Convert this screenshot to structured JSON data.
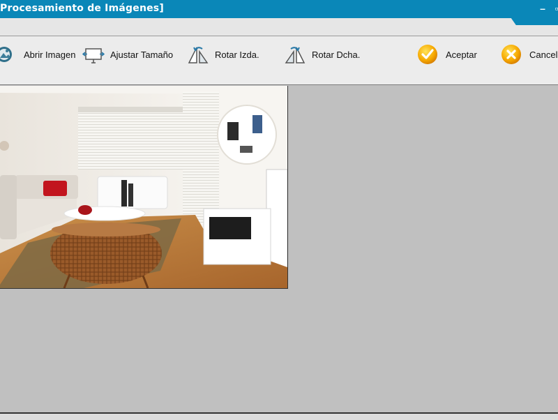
{
  "window": {
    "title": "Procesamiento de Imágenes]",
    "minimize_glyph": "–",
    "maximize_glyph": "▫",
    "accent_color": "#0a87b8"
  },
  "toolbar": {
    "open_label": "Abrir Imagen",
    "fit_label": "Ajustar Tamaño",
    "rotate_left_label": "Rotar Izda.",
    "rotate_right_label": "Rotar Dcha.",
    "accept_label": "Aceptar",
    "cancel_label": "Cancela"
  },
  "icons": {
    "open": "open-image-icon",
    "fit": "resize-icon",
    "rotate_left": "rotate-left-icon",
    "rotate_right": "rotate-right-icon",
    "accept": "checkmark-icon",
    "cancel": "cancel-x-icon"
  },
  "canvas": {
    "background_color": "#c0c0c0",
    "image_subject": "living-room-photo"
  }
}
